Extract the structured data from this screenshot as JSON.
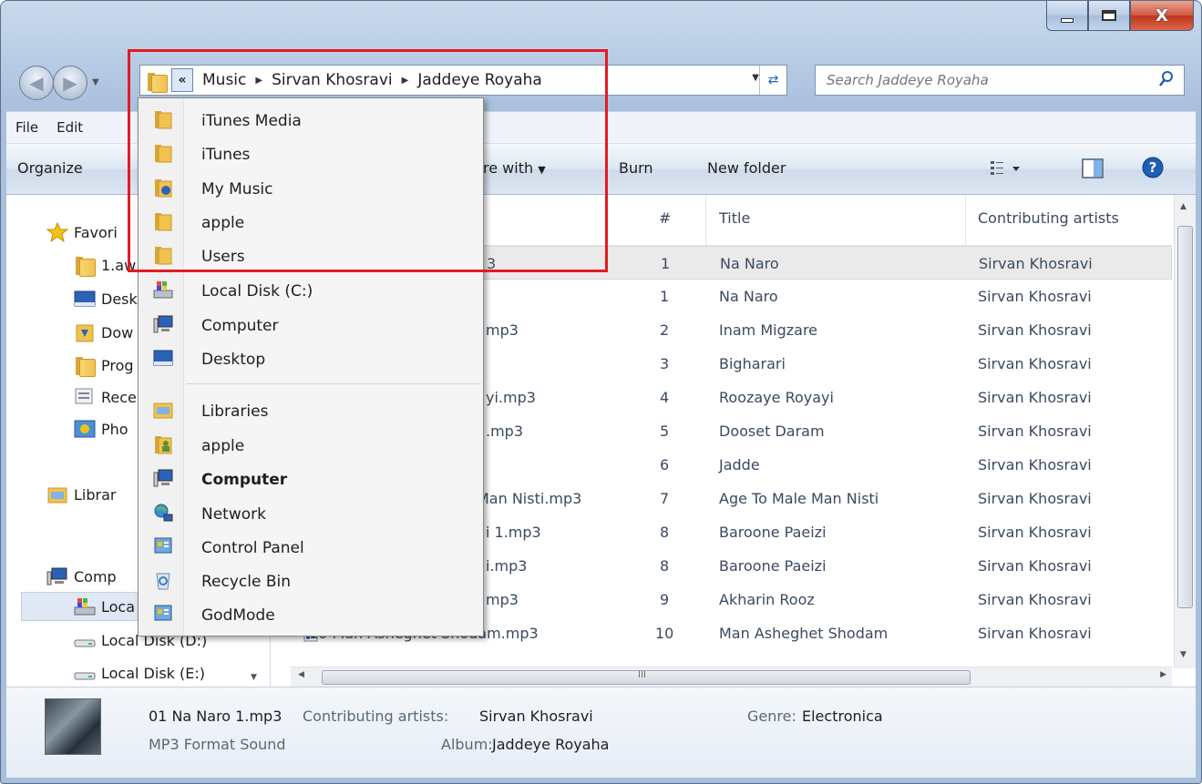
{
  "window": {
    "caption": {
      "minimize": "▁",
      "maximize": "▢",
      "close": "X"
    }
  },
  "address": {
    "chevron": "«",
    "crumbs": [
      "Music",
      "Sirvan Khosravi",
      "Jaddeye Royaha"
    ]
  },
  "search": {
    "placeholder": "Search Jaddeye Royaha"
  },
  "menubar": {
    "items": [
      "File",
      "Edit"
    ]
  },
  "toolbar": {
    "organize": "Organize",
    "share_with": "re with",
    "burn": "Burn",
    "new_folder": "New folder"
  },
  "navpane": {
    "items": [
      {
        "label": "Favori",
        "icon": "star-icon"
      },
      {
        "label": "1.aw",
        "icon": "folder-icon"
      },
      {
        "label": "Desk",
        "icon": "desktop-icon"
      },
      {
        "label": "Dow",
        "icon": "downloads-icon"
      },
      {
        "label": "Prog",
        "icon": "folder-icon"
      },
      {
        "label": "Rece",
        "icon": "recent-icon"
      },
      {
        "label": "Pho",
        "icon": "photos-icon"
      },
      {
        "label": "Librar",
        "icon": "libraries-icon"
      },
      {
        "label": "Comp",
        "icon": "computer-icon"
      },
      {
        "label": "Loca",
        "icon": "local-disk-icon"
      },
      {
        "label": "Local Disk (D:)",
        "icon": "drive-icon"
      },
      {
        "label": "Local Disk (E:)",
        "icon": "drive-icon"
      }
    ]
  },
  "filelist": {
    "columns": {
      "number": "#",
      "title": "Title",
      "artists": "Contributing artists"
    },
    "rows": [
      {
        "name": "3",
        "num": "1",
        "title": "Na Naro",
        "artist": "Sirvan Khosravi"
      },
      {
        "name": "",
        "num": "1",
        "title": "Na Naro",
        "artist": "Sirvan Khosravi"
      },
      {
        "name": "mp3",
        "num": "2",
        "title": "Inam Migzare",
        "artist": "Sirvan Khosravi"
      },
      {
        "name": "",
        "num": "3",
        "title": "Bigharari",
        "artist": "Sirvan Khosravi"
      },
      {
        "name": "yi.mp3",
        "num": "4",
        "title": "Roozaye Royayi",
        "artist": "Sirvan Khosravi"
      },
      {
        "name": ".mp3",
        "num": "5",
        "title": "Dooset Daram",
        "artist": "Sirvan Khosravi"
      },
      {
        "name": "",
        "num": "6",
        "title": "Jadde",
        "artist": "Sirvan Khosravi"
      },
      {
        "name": "Man Nisti.mp3",
        "num": "7",
        "title": "Age To Male Man Nisti",
        "artist": "Sirvan Khosravi"
      },
      {
        "name": "i 1.mp3",
        "num": "8",
        "title": "Baroone Paeizi",
        "artist": "Sirvan Khosravi"
      },
      {
        "name": "i.mp3",
        "num": "8",
        "title": "Baroone Paeizi",
        "artist": "Sirvan Khosravi"
      },
      {
        "name": "mp3",
        "num": "9",
        "title": "Akharin Rooz",
        "artist": "Sirvan Khosravi"
      },
      {
        "name": "10 Man Asheghet Shodam.mp3",
        "num": "10",
        "title": "Man Asheghet Shodam",
        "artist": "Sirvan Khosravi"
      }
    ],
    "hscroll_marker": "III"
  },
  "details": {
    "filename": "01 Na Naro 1.mp3",
    "filetype": "MP3 Format Sound",
    "artists_label": "Contributing artists:",
    "artists_value": "Sirvan Khosravi",
    "album_label": "Album:",
    "album_value": "Jaddeye Royaha",
    "genre_label": "Genre:",
    "genre_value": "Electronica"
  },
  "popup": {
    "items": [
      {
        "label": "iTunes Media",
        "icon": "folder-icon",
        "bold": false
      },
      {
        "label": "iTunes",
        "icon": "folder-icon",
        "bold": false
      },
      {
        "label": "My Music",
        "icon": "music-folder-icon",
        "bold": false
      },
      {
        "label": "apple",
        "icon": "folder-icon",
        "bold": false
      },
      {
        "label": "Users",
        "icon": "folder-icon",
        "bold": false
      },
      {
        "label": "Local Disk (C:)",
        "icon": "local-disk-icon",
        "bold": false
      },
      {
        "label": "Computer",
        "icon": "computer-icon",
        "bold": false
      },
      {
        "label": "Desktop",
        "icon": "desktop-icon",
        "bold": false
      },
      {
        "label": "Libraries",
        "icon": "libraries-icon",
        "bold": false
      },
      {
        "label": "apple",
        "icon": "user-folder-icon",
        "bold": false
      },
      {
        "label": "Computer",
        "icon": "computer-icon",
        "bold": true
      },
      {
        "label": "Network",
        "icon": "network-icon",
        "bold": false
      },
      {
        "label": "Control Panel",
        "icon": "control-panel-icon",
        "bold": false
      },
      {
        "label": "Recycle Bin",
        "icon": "recycle-bin-icon",
        "bold": false
      },
      {
        "label": "GodMode",
        "icon": "control-panel-icon",
        "bold": false
      }
    ]
  },
  "colors": {
    "highlight": "#e31b23",
    "selection": "#eaeaea",
    "help": "#1f5fb4"
  }
}
